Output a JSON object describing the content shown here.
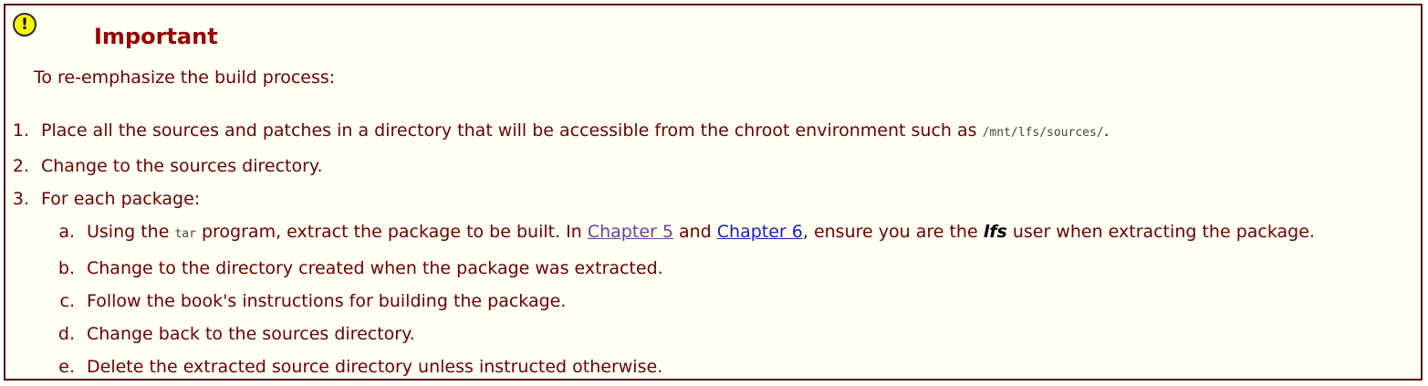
{
  "icon": "warning-exclamation-icon",
  "title": "Important",
  "intro": "To re-emphasize the build process:",
  "steps": [
    {
      "marker": "1.",
      "text_before": "Place all the sources and patches in a directory that will be accessible from the chroot environment such as ",
      "code": "/mnt/lfs/sources/",
      "text_after": "."
    },
    {
      "marker": "2.",
      "text": "Change to the sources directory."
    },
    {
      "marker": "3.",
      "text": "For each package:"
    }
  ],
  "substeps": [
    {
      "marker": "a.",
      "t1": "Using the ",
      "code": "tar",
      "t2": " program, extract the package to be built. In ",
      "link1": "Chapter 5",
      "t3": " and ",
      "link2": "Chapter 6",
      "t4": ", ensure you are the ",
      "user": "lfs",
      "t5": " user when extracting the package."
    },
    {
      "marker": "b.",
      "text": "Change to the directory created when the package was extracted."
    },
    {
      "marker": "c.",
      "text": "Follow the book's instructions for building the package."
    },
    {
      "marker": "d.",
      "text": "Change back to the sources directory."
    },
    {
      "marker": "e.",
      "text": "Delete the extracted source directory unless instructed otherwise."
    }
  ],
  "colors": {
    "border": "#5a0a0a",
    "background": "#fffff4",
    "text": "#6b0000",
    "title": "#990000",
    "visited_link": "#6b3fa0",
    "link": "#1a22aa"
  }
}
